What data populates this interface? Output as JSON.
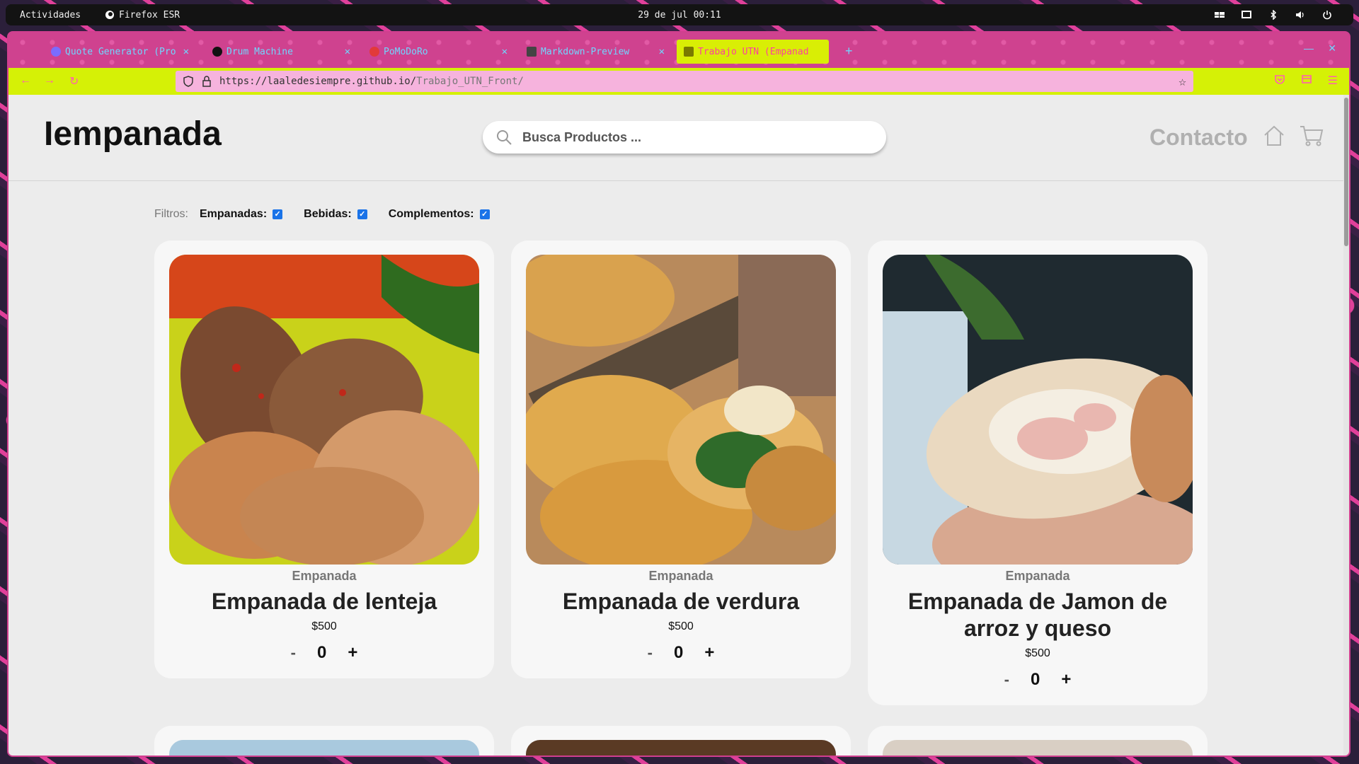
{
  "system": {
    "activities": "Actividades",
    "app": "Firefox ESR",
    "clock": "29 de jul 00:11"
  },
  "browser": {
    "tabs": [
      {
        "title": "Quote Generator (Pro",
        "favicon_color": "#7b6cff"
      },
      {
        "title": "Drum Machine",
        "favicon_color": "#111111"
      },
      {
        "title": "PoMoDoRo",
        "favicon_color": "#e23a3a"
      },
      {
        "title": "Markdown-Preview",
        "favicon_color": "#444444"
      },
      {
        "title": "Trabajo UTN (Empanad",
        "favicon_color": "#7a7a00",
        "active": true
      }
    ],
    "url_host": "https://laaledesiempre.github.io/",
    "url_path": "Trabajo_UTN_Front/"
  },
  "site": {
    "logo": "Iempanada",
    "search_placeholder": "Busca Productos ...",
    "contacto": "Contacto"
  },
  "filters": {
    "label": "Filtros:",
    "items": [
      {
        "label": "Empanadas:",
        "checked": true
      },
      {
        "label": "Bebidas:",
        "checked": true
      },
      {
        "label": "Complementos:",
        "checked": true
      }
    ]
  },
  "products": [
    {
      "category": "Empanada",
      "name": "Empanada de lenteja",
      "price": "$500",
      "qty": "0",
      "minus": "-",
      "plus": "+"
    },
    {
      "category": "Empanada",
      "name": "Empanada de verdura",
      "price": "$500",
      "qty": "0",
      "minus": "-",
      "plus": "+"
    },
    {
      "category": "Empanada",
      "name": "Empanada de Jamon de arroz y queso",
      "price": "$500",
      "qty": "0",
      "minus": "-",
      "plus": "+"
    }
  ],
  "colors": {
    "tab_active": "#d9ee05",
    "tabstrip": "#cf428f",
    "navbar": "#d5f106",
    "urlbar": "#f6b3dd",
    "checkbox": "#1a73e8"
  }
}
